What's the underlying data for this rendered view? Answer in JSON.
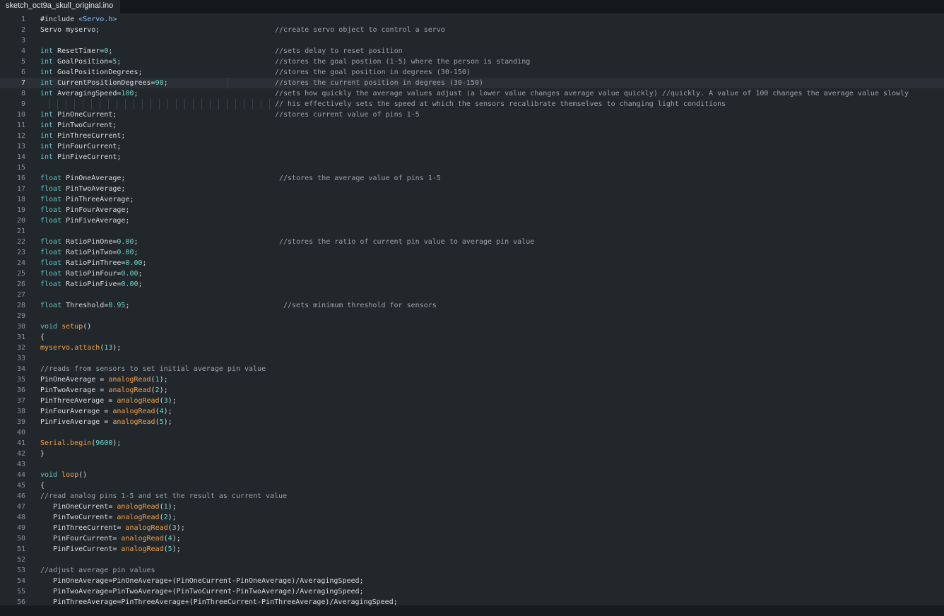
{
  "tab": {
    "title": "sketch_oct9a_skull_original.ino"
  },
  "editor": {
    "active_line": 7,
    "lines": [
      {
        "n": "1",
        "code": [
          [
            "pp",
            "#include "
          ],
          [
            "st",
            "<Servo.h>"
          ]
        ],
        "comment": ""
      },
      {
        "n": "2",
        "code": [
          [
            "pl",
            "Servo myservo;"
          ]
        ],
        "comment": "//create servo object to control a servo",
        "ci": 1
      },
      {
        "n": "3",
        "code": [],
        "comment": ""
      },
      {
        "n": "4",
        "code": [
          [
            "kw",
            "int"
          ],
          [
            "pl",
            " ResetTimer="
          ],
          [
            "nm",
            "0"
          ],
          [
            "pl",
            ";"
          ]
        ],
        "comment": "//sets delay to reset position",
        "ci": 1
      },
      {
        "n": "5",
        "code": [
          [
            "kw",
            "int"
          ],
          [
            "pl",
            " GoalPosition="
          ],
          [
            "nm",
            "5"
          ],
          [
            "pl",
            ";"
          ]
        ],
        "comment": "//stores the goal postion (1-5) where the person is standing",
        "ci": 1
      },
      {
        "n": "6",
        "code": [
          [
            "kw",
            "int"
          ],
          [
            "pl",
            " GoalPositionDegrees;"
          ]
        ],
        "comment": "//stores the goal position in degrees (30-150)",
        "ci": 1
      },
      {
        "n": "7",
        "code": [
          [
            "kw",
            "int"
          ],
          [
            "pl",
            " CurrentPositionDegrees="
          ],
          [
            "nm",
            "90"
          ],
          [
            "pl",
            ";"
          ]
        ],
        "comment": "//stores the current position in degrees (30-150)",
        "ci": 1
      },
      {
        "n": "8",
        "code": [
          [
            "kw",
            "int"
          ],
          [
            "pl",
            " AveragingSpeed="
          ],
          [
            "nm",
            "100"
          ],
          [
            "pl",
            ";"
          ]
        ],
        "comment": "//sets how quickly the average values adjust (a lower value changes average value quickly) //quickly. A value of 100 changes the average value slowly",
        "ci": 1
      },
      {
        "n": "9",
        "code": [],
        "comment": "// his effectively sets the speed at which the sensors recalibrate themselves to changing light conditions",
        "ci": 1
      },
      {
        "n": "10",
        "code": [
          [
            "kw",
            "int"
          ],
          [
            "pl",
            " PinOneCurrent;"
          ]
        ],
        "comment": "//stores current value of pins 1-5",
        "ci": 1
      },
      {
        "n": "11",
        "code": [
          [
            "kw",
            "int"
          ],
          [
            "pl",
            " PinTwoCurrent;"
          ]
        ],
        "comment": ""
      },
      {
        "n": "12",
        "code": [
          [
            "kw",
            "int"
          ],
          [
            "pl",
            " PinThreeCurrent;"
          ]
        ],
        "comment": ""
      },
      {
        "n": "13",
        "code": [
          [
            "kw",
            "int"
          ],
          [
            "pl",
            " PinFourCurrent;"
          ]
        ],
        "comment": ""
      },
      {
        "n": "14",
        "code": [
          [
            "kw",
            "int"
          ],
          [
            "pl",
            " PinFiveCurrent;"
          ]
        ],
        "comment": ""
      },
      {
        "n": "15",
        "code": [],
        "comment": ""
      },
      {
        "n": "16",
        "code": [
          [
            "kw",
            "float"
          ],
          [
            "pl",
            " PinOneAverage;"
          ]
        ],
        "comment": "//stores the average value of pins 1-5",
        "ci": 2
      },
      {
        "n": "17",
        "code": [
          [
            "kw",
            "float"
          ],
          [
            "pl",
            " PinTwoAverage;"
          ]
        ],
        "comment": ""
      },
      {
        "n": "18",
        "code": [
          [
            "kw",
            "float"
          ],
          [
            "pl",
            " PinThreeAverage;"
          ]
        ],
        "comment": ""
      },
      {
        "n": "19",
        "code": [
          [
            "kw",
            "float"
          ],
          [
            "pl",
            " PinFourAverage;"
          ]
        ],
        "comment": ""
      },
      {
        "n": "20",
        "code": [
          [
            "kw",
            "float"
          ],
          [
            "pl",
            " PinFiveAverage;"
          ]
        ],
        "comment": ""
      },
      {
        "n": "21",
        "code": [],
        "comment": ""
      },
      {
        "n": "22",
        "code": [
          [
            "kw",
            "float"
          ],
          [
            "pl",
            " RatioPinOne="
          ],
          [
            "nm",
            "0.00"
          ],
          [
            "pl",
            ";"
          ]
        ],
        "comment": "//stores the ratio of current pin value to average pin value",
        "ci": 2
      },
      {
        "n": "23",
        "code": [
          [
            "kw",
            "float"
          ],
          [
            "pl",
            " RatioPinTwo="
          ],
          [
            "nm",
            "0.00"
          ],
          [
            "pl",
            ";"
          ]
        ],
        "comment": ""
      },
      {
        "n": "24",
        "code": [
          [
            "kw",
            "float"
          ],
          [
            "pl",
            " RatioPinThree="
          ],
          [
            "nm",
            "0.00"
          ],
          [
            "pl",
            ";"
          ]
        ],
        "comment": ""
      },
      {
        "n": "25",
        "code": [
          [
            "kw",
            "float"
          ],
          [
            "pl",
            " RatioPinFour="
          ],
          [
            "nm",
            "0.00"
          ],
          [
            "pl",
            ";"
          ]
        ],
        "comment": ""
      },
      {
        "n": "26",
        "code": [
          [
            "kw",
            "float"
          ],
          [
            "pl",
            " RatioPinFive="
          ],
          [
            "nm",
            "0.00"
          ],
          [
            "pl",
            ";"
          ]
        ],
        "comment": ""
      },
      {
        "n": "27",
        "code": [],
        "comment": ""
      },
      {
        "n": "28",
        "code": [
          [
            "kw",
            "float"
          ],
          [
            "pl",
            " Threshold="
          ],
          [
            "nm",
            "0.95"
          ],
          [
            "pl",
            ";"
          ]
        ],
        "comment": "//sets minimum threshold for sensors",
        "ci": 3
      },
      {
        "n": "29",
        "code": [],
        "comment": ""
      },
      {
        "n": "30",
        "code": [
          [
            "kw",
            "void"
          ],
          [
            "pl",
            " "
          ],
          [
            "fn",
            "setup"
          ],
          [
            "pl",
            "()"
          ]
        ],
        "comment": ""
      },
      {
        "n": "31",
        "code": [
          [
            "pl",
            "{"
          ]
        ],
        "comment": ""
      },
      {
        "n": "32",
        "code": [
          [
            "fn",
            "myservo"
          ],
          [
            "pl",
            "."
          ],
          [
            "fn",
            "attach"
          ],
          [
            "pl",
            "("
          ],
          [
            "nm",
            "13"
          ],
          [
            "pl",
            ");"
          ]
        ],
        "comment": ""
      },
      {
        "n": "33",
        "code": [],
        "comment": ""
      },
      {
        "n": "34",
        "code": [
          [
            "cm",
            "//reads from sensors to set initial average pin value"
          ]
        ],
        "comment": ""
      },
      {
        "n": "35",
        "code": [
          [
            "pl",
            "PinOneAverage = "
          ],
          [
            "fn",
            "analogRead"
          ],
          [
            "pl",
            "("
          ],
          [
            "nm",
            "1"
          ],
          [
            "pl",
            ");"
          ]
        ],
        "comment": ""
      },
      {
        "n": "36",
        "code": [
          [
            "pl",
            "PinTwoAverage = "
          ],
          [
            "fn",
            "analogRead"
          ],
          [
            "pl",
            "("
          ],
          [
            "nm",
            "2"
          ],
          [
            "pl",
            ");"
          ]
        ],
        "comment": ""
      },
      {
        "n": "37",
        "code": [
          [
            "pl",
            "PinThreeAverage = "
          ],
          [
            "fn",
            "analogRead"
          ],
          [
            "pl",
            "("
          ],
          [
            "nm",
            "3"
          ],
          [
            "pl",
            ");"
          ]
        ],
        "comment": ""
      },
      {
        "n": "38",
        "code": [
          [
            "pl",
            "PinFourAverage = "
          ],
          [
            "fn",
            "analogRead"
          ],
          [
            "pl",
            "("
          ],
          [
            "nm",
            "4"
          ],
          [
            "pl",
            ");"
          ]
        ],
        "comment": ""
      },
      {
        "n": "39",
        "code": [
          [
            "pl",
            "PinFiveAverage = "
          ],
          [
            "fn",
            "analogRead"
          ],
          [
            "pl",
            "("
          ],
          [
            "nm",
            "5"
          ],
          [
            "pl",
            ");"
          ]
        ],
        "comment": ""
      },
      {
        "n": "40",
        "code": [],
        "comment": ""
      },
      {
        "n": "41",
        "code": [
          [
            "fn",
            "Serial"
          ],
          [
            "pl",
            "."
          ],
          [
            "fn",
            "begin"
          ],
          [
            "pl",
            "("
          ],
          [
            "nm",
            "9600"
          ],
          [
            "pl",
            ");"
          ]
        ],
        "comment": ""
      },
      {
        "n": "42",
        "code": [
          [
            "pl",
            "}"
          ]
        ],
        "comment": ""
      },
      {
        "n": "43",
        "code": [],
        "comment": ""
      },
      {
        "n": "44",
        "code": [
          [
            "kw",
            "void"
          ],
          [
            "pl",
            " "
          ],
          [
            "fn",
            "loop"
          ],
          [
            "pl",
            "()"
          ]
        ],
        "comment": ""
      },
      {
        "n": "45",
        "code": [
          [
            "pl",
            "{"
          ]
        ],
        "comment": ""
      },
      {
        "n": "46",
        "code": [
          [
            "cm",
            "//read analog pins 1-5 and set the result as current value"
          ]
        ],
        "comment": ""
      },
      {
        "n": "47",
        "code": [
          [
            "pl",
            "   PinOneCurrent= "
          ],
          [
            "fn",
            "analogRead"
          ],
          [
            "pl",
            "("
          ],
          [
            "nm",
            "1"
          ],
          [
            "pl",
            ");"
          ]
        ],
        "comment": ""
      },
      {
        "n": "48",
        "code": [
          [
            "pl",
            "   PinTwoCurrent= "
          ],
          [
            "fn",
            "analogRead"
          ],
          [
            "pl",
            "("
          ],
          [
            "nm",
            "2"
          ],
          [
            "pl",
            ");"
          ]
        ],
        "comment": ""
      },
      {
        "n": "49",
        "code": [
          [
            "pl",
            "   PinThreeCurrent= "
          ],
          [
            "fn",
            "analogRead"
          ],
          [
            "pl",
            "("
          ],
          [
            "nm",
            "3"
          ],
          [
            "pl",
            ");"
          ]
        ],
        "comment": ""
      },
      {
        "n": "50",
        "code": [
          [
            "pl",
            "   PinFourCurrent= "
          ],
          [
            "fn",
            "analogRead"
          ],
          [
            "pl",
            "("
          ],
          [
            "nm",
            "4"
          ],
          [
            "pl",
            ");"
          ]
        ],
        "comment": ""
      },
      {
        "n": "51",
        "code": [
          [
            "pl",
            "   PinFiveCurrent= "
          ],
          [
            "fn",
            "analogRead"
          ],
          [
            "pl",
            "("
          ],
          [
            "nm",
            "5"
          ],
          [
            "pl",
            ");"
          ]
        ],
        "comment": ""
      },
      {
        "n": "52",
        "code": [],
        "comment": ""
      },
      {
        "n": "53",
        "code": [
          [
            "cm",
            "//adjust average pin values"
          ]
        ],
        "comment": ""
      },
      {
        "n": "54",
        "code": [
          [
            "pl",
            "   PinOneAverage=PinOneAverage+(PinOneCurrent-PinOneAverage)/AveragingSpeed;"
          ]
        ],
        "comment": ""
      },
      {
        "n": "55",
        "code": [
          [
            "pl",
            "   PinTwoAverage=PinTwoAverage+(PinTwoCurrent-PinTwoAverage)/AveragingSpeed;"
          ]
        ],
        "comment": ""
      },
      {
        "n": "56",
        "code": [
          [
            "pl",
            "   PinThreeAverage=PinThreeAverage+(PinThreeCurrent-PinThreeAverage)/AveragingSpeed;"
          ]
        ],
        "comment": ""
      }
    ]
  }
}
